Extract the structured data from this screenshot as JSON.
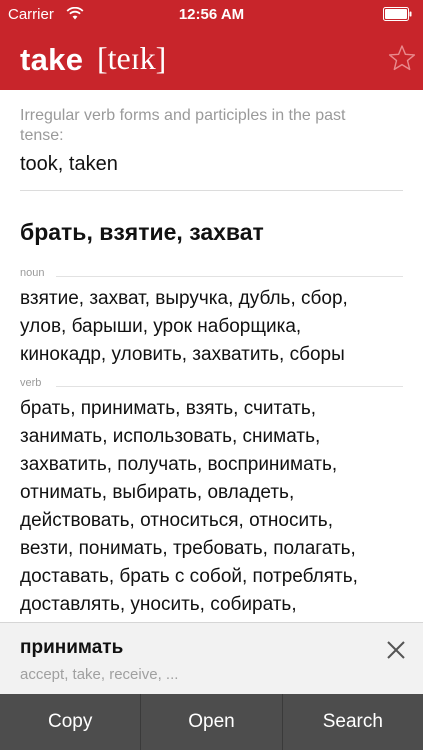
{
  "status_bar": {
    "carrier": "Carrier",
    "time": "12:56 AM"
  },
  "header": {
    "word": "take",
    "transcription": "[teɪk]",
    "background_color": "#c8252b"
  },
  "entry": {
    "irregular_label": "Irregular verb forms and participles in the past tense:",
    "irregular_forms": "took, taken",
    "main_translation": "брать, взятие, захват",
    "sections": [
      {
        "pos": "noun",
        "lines": [
          "взятие, захват, выручка, дубль, сбор,",
          "улов, барыши, урок наборщика,",
          "кинокадр, уловить, захватить, сборы"
        ]
      },
      {
        "pos": "verb",
        "lines": [
          "брать, принимать, взять, считать,",
          "занимать, использовать, снимать,",
          "захватить, получать, воспринимать,",
          "отнимать, выбирать, овладеть,",
          "действовать, относиться, относить,",
          "везти, понимать, требовать, полагать,",
          "доставать, брать с собой, потреблять,",
          "доставлять, уносить, собирать,"
        ]
      }
    ]
  },
  "popup": {
    "word": "принимать",
    "translations": "accept, take, receive, ..."
  },
  "actions": {
    "copy": "Copy",
    "open": "Open",
    "search": "Search"
  }
}
